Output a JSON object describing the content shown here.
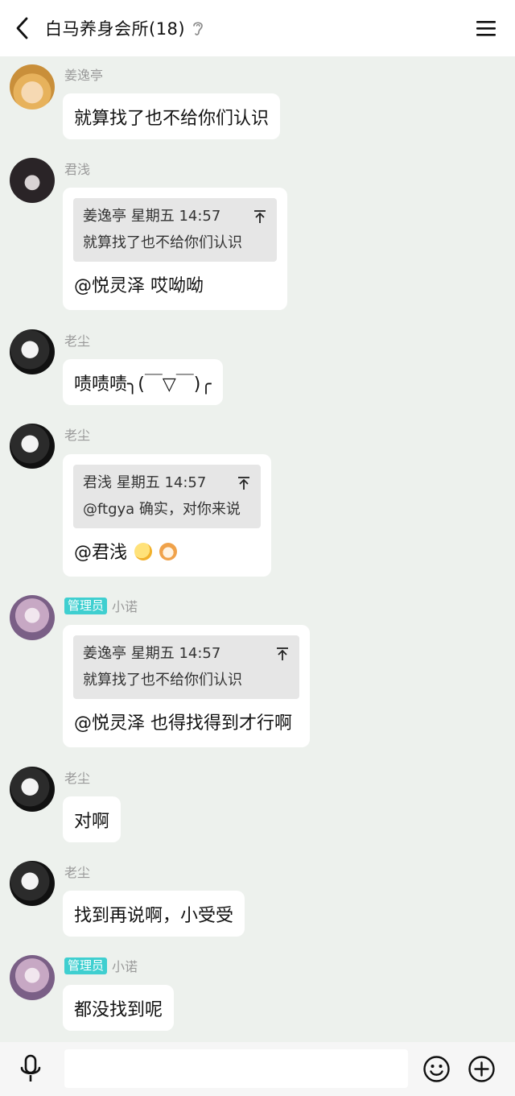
{
  "header": {
    "title": "白马养身会所(18)",
    "back_icon": "chevron-left-icon",
    "ear_icon": "ear-icon",
    "menu_icon": "hamburger-menu-icon"
  },
  "messages": [
    {
      "sender": "姜逸亭",
      "badge": "",
      "text": "就算找了也不给你们认识"
    },
    {
      "sender": "君浅",
      "badge": "",
      "quote_head": "姜逸亭 星期五 14:57",
      "quote_text": "就算找了也不给你们认识",
      "text": "@悦灵泽 哎呦呦"
    },
    {
      "sender": "老尘",
      "badge": "",
      "text": "啧啧啧╮(￣▽￣)╭"
    },
    {
      "sender": "老尘",
      "badge": "",
      "quote_head": "君浅 星期五 14:57",
      "quote_text": "@ftgya 确实，对你来说",
      "text": "@君浅"
    },
    {
      "sender": "小诺",
      "badge": "管理员",
      "quote_head": "姜逸亭 星期五 14:57",
      "quote_text": "就算找了也不给你们认识",
      "text": "@悦灵泽 也得找得到才行啊"
    },
    {
      "sender": "老尘",
      "badge": "",
      "text": "对啊"
    },
    {
      "sender": "老尘",
      "badge": "",
      "text": "找到再说啊，小受受"
    },
    {
      "sender": "小诺",
      "badge": "管理员",
      "text": "都没找到呢"
    }
  ],
  "footer": {
    "input_placeholder": "",
    "mic_icon": "microphone-icon",
    "emoji_icon": "smiley-icon",
    "plus_icon": "plus-circle-icon"
  },
  "colors": {
    "chat_background": "#edf1ed",
    "badge_background": "#3fcfd0",
    "bubble_background": "#ffffff",
    "quote_background": "#e6e6e6"
  }
}
